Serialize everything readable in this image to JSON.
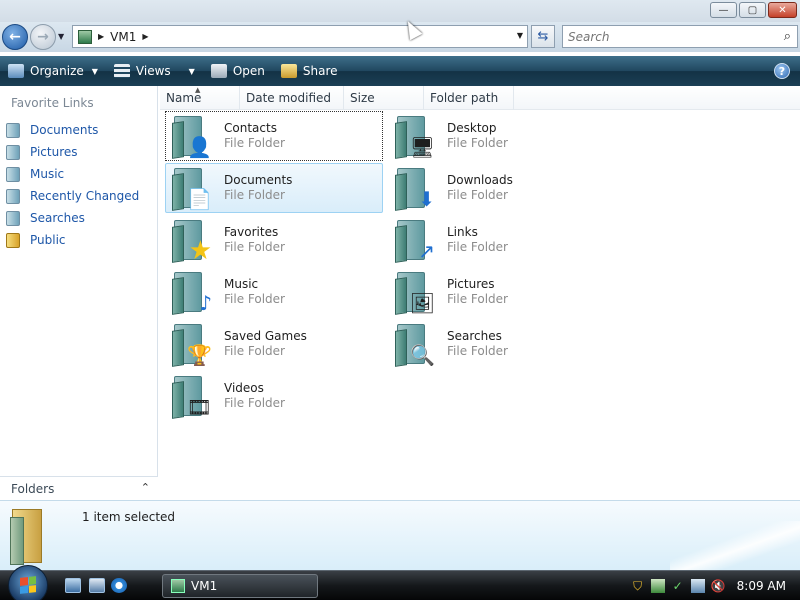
{
  "window": {
    "minimize_glyph": "—",
    "maximize_glyph": "▢",
    "close_glyph": "✕"
  },
  "address": {
    "path_item": "VM1",
    "back_glyph": "←",
    "forward_glyph": "→",
    "refresh_glyph": "⇆"
  },
  "search": {
    "placeholder": "Search"
  },
  "toolbar": {
    "organize": "Organize",
    "views": "Views",
    "open": "Open",
    "share": "Share",
    "help": "?"
  },
  "sidebar": {
    "title": "Favorite Links",
    "items": [
      {
        "label": "Documents",
        "icon": "documents-icon"
      },
      {
        "label": "Pictures",
        "icon": "pictures-icon"
      },
      {
        "label": "Music",
        "icon": "music-icon"
      },
      {
        "label": "Recently Changed",
        "icon": "recently-changed-icon"
      },
      {
        "label": "Searches",
        "icon": "searches-icon"
      },
      {
        "label": "Public",
        "icon": "public-folder-icon"
      }
    ],
    "folders_label": "Folders"
  },
  "columns": {
    "name": "Name",
    "date_modified": "Date modified",
    "size": "Size",
    "folder_path": "Folder path"
  },
  "files": [
    {
      "name": "Contacts",
      "type": "File Folder",
      "glyph": "👤",
      "icon": "contacts-folder-icon"
    },
    {
      "name": "Desktop",
      "type": "File Folder",
      "glyph": "🖥",
      "icon": "desktop-folder-icon"
    },
    {
      "name": "Documents",
      "type": "File Folder",
      "glyph": "📄",
      "icon": "documents-folder-icon"
    },
    {
      "name": "Downloads",
      "type": "File Folder",
      "glyph": "⬇",
      "icon": "downloads-folder-icon"
    },
    {
      "name": "Favorites",
      "type": "File Folder",
      "glyph": "★",
      "icon": "favorites-folder-icon"
    },
    {
      "name": "Links",
      "type": "File Folder",
      "glyph": "↗",
      "icon": "links-folder-icon"
    },
    {
      "name": "Music",
      "type": "File Folder",
      "glyph": "♪",
      "icon": "music-folder-icon"
    },
    {
      "name": "Pictures",
      "type": "File Folder",
      "glyph": "🖼",
      "icon": "pictures-folder-icon"
    },
    {
      "name": "Saved Games",
      "type": "File Folder",
      "glyph": "🏆",
      "icon": "saved-games-folder-icon"
    },
    {
      "name": "Searches",
      "type": "File Folder",
      "glyph": "🔍",
      "icon": "searches-folder-icon"
    },
    {
      "name": "Videos",
      "type": "File Folder",
      "glyph": "🎞",
      "icon": "videos-folder-icon"
    }
  ],
  "details": {
    "status": "1 item selected"
  },
  "taskbar": {
    "task_label": "VM1",
    "clock": "8:09 AM"
  }
}
